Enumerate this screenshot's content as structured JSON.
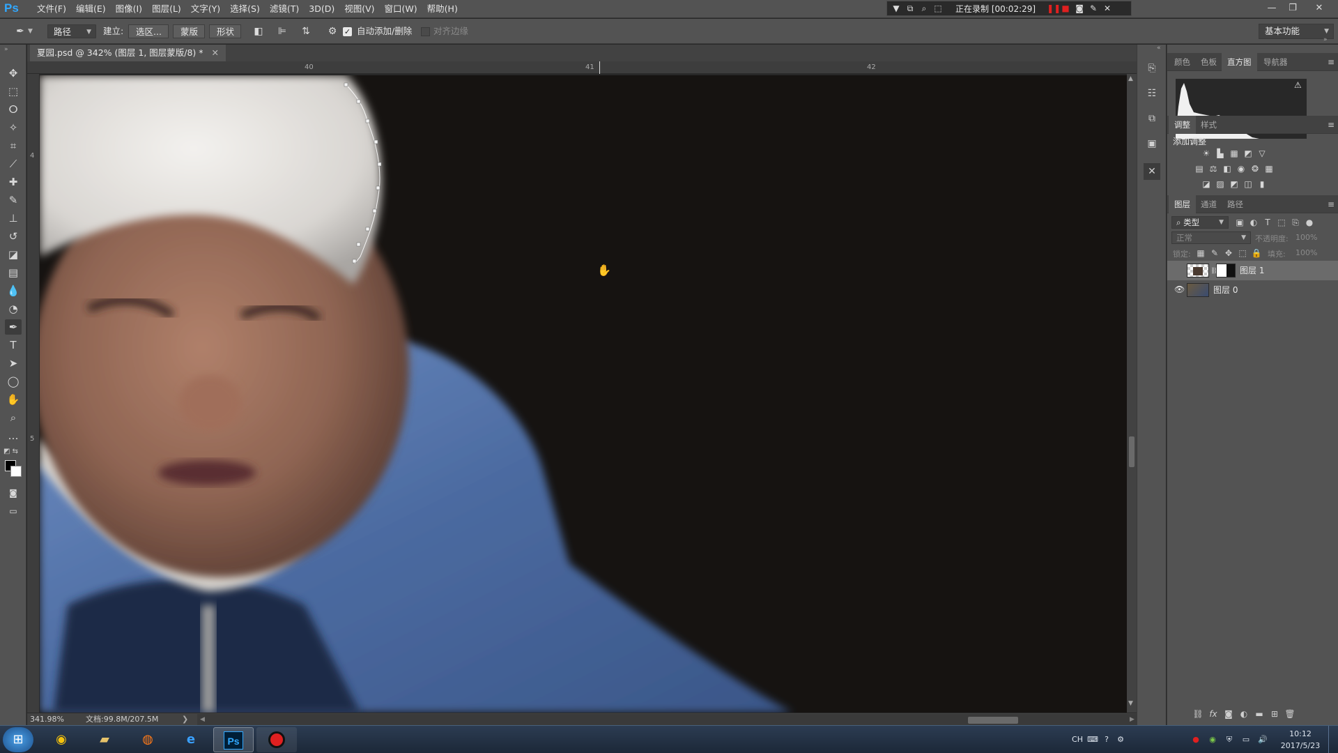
{
  "app": {
    "logo_text": "Ps"
  },
  "menu": [
    "文件(F)",
    "编辑(E)",
    "图像(I)",
    "图层(L)",
    "文字(Y)",
    "选择(S)",
    "滤镜(T)",
    "3D(D)",
    "视图(V)",
    "窗口(W)",
    "帮助(H)"
  ],
  "recording": {
    "status": "正在录制 [00:02:29]"
  },
  "options": {
    "tool_mode": "路径",
    "make_label": "建立:",
    "selection_btn": "选区...",
    "mask_btn": "蒙版",
    "shape_btn": "形状",
    "auto_add_delete_label": "自动添加/删除",
    "auto_add_delete": true,
    "align_edges_label": "对齐边缘",
    "workspace": "基本功能"
  },
  "document": {
    "tab_title": "夏园.psd @ 342% (图层 1, 图层蒙版/8) *",
    "ruler_h_labels": [
      "40",
      "41",
      "42"
    ],
    "ruler_v_labels": [
      "4",
      "5"
    ]
  },
  "status": {
    "zoom": "341.98%",
    "doc_info": "文档:99.8M/207.5M"
  },
  "panels": {
    "top_tabs": [
      "颜色",
      "色板",
      "直方图",
      "导航器"
    ],
    "top_active": "直方图",
    "adjust_tabs": [
      "调整",
      "样式"
    ],
    "adjust_active": "调整",
    "add_adjustment_label": "添加调整",
    "layers_tabs": [
      "图层",
      "通道",
      "路径"
    ],
    "layers_active": "图层",
    "filter_kind": "类型",
    "blend_mode": "正常",
    "opacity_label": "不透明度:",
    "opacity_value": "100%",
    "lock_label": "锁定:",
    "fill_label": "填充:",
    "fill_value": "100%"
  },
  "layers": [
    {
      "name": "图层 1",
      "visible": false,
      "selected": true,
      "has_mask": true
    },
    {
      "name": "图层 0",
      "visible": true,
      "selected": false,
      "has_mask": false
    }
  ],
  "taskbar": {
    "tray_lang": "CH",
    "time": "10:12",
    "date": "2017/5/23"
  },
  "colors": {
    "ps_blue": "#31a8ff",
    "panel_bg": "#535353",
    "path_anchor": "#ffffff",
    "record_red": "#e02020"
  }
}
